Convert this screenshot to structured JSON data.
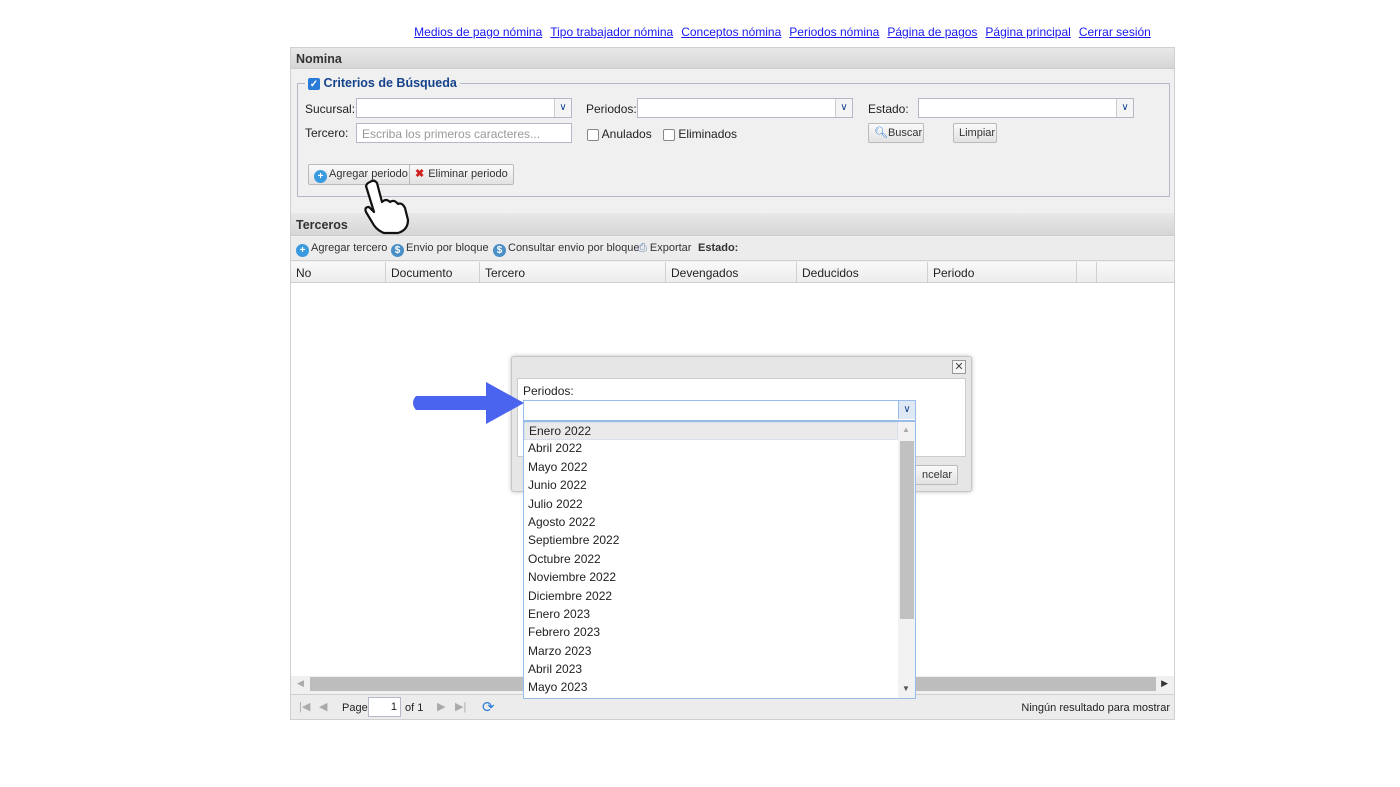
{
  "nav_links": [
    "Medios de pago nómina",
    "Tipo trabajador nómina",
    "Conceptos nómina",
    "Periodos nómina",
    "Página de pagos",
    "Página principal",
    "Cerrar sesión"
  ],
  "nomina": {
    "title": "Nomina",
    "criteria_legend": "Criterios de Búsqueda",
    "sucursal_label": "Sucursal:",
    "periodos_label": "Periodos:",
    "estado_label": "Estado:",
    "tercero_label": "Tercero:",
    "tercero_placeholder": "Escriba los primeros caracteres...",
    "anulados": "Anulados",
    "eliminados": "Eliminados",
    "buscar": "Buscar",
    "limpiar": "Limpiar",
    "agregar_periodo": "Agregar periodo",
    "eliminar_periodo": "Eliminar periodo"
  },
  "terceros": {
    "title": "Terceros",
    "toolbar": [
      "Agregar tercero",
      "Envio por bloque",
      "Consultar envio por bloque",
      "Exportar"
    ],
    "estado_label": "Estado:",
    "columns": [
      "No",
      "Documento",
      "Tercero",
      "Devengados",
      "Deducidos",
      "Periodo"
    ]
  },
  "paging": {
    "page_label": "Page",
    "page_value": "1",
    "of_label": "of 1",
    "status": "Ningún resultado para mostrar"
  },
  "dialog": {
    "periodos_label": "Periodos:",
    "cancel_label": "Cancelar",
    "cancel_visible": "ncelar",
    "options": [
      "Enero 2022",
      "Abril 2022",
      "Mayo 2022",
      "Junio 2022",
      "Julio 2022",
      "Agosto 2022",
      "Septiembre 2022",
      "Octubre 2022",
      "Noviembre 2022",
      "Diciembre 2022",
      "Enero 2023",
      "Febrero 2023",
      "Marzo 2023",
      "Abril 2023",
      "Mayo 2023"
    ],
    "selected": "Enero 2022"
  },
  "colors": {
    "link": "#1a1aee",
    "arrow": "#4a64f0",
    "header_text": "#15428b"
  }
}
